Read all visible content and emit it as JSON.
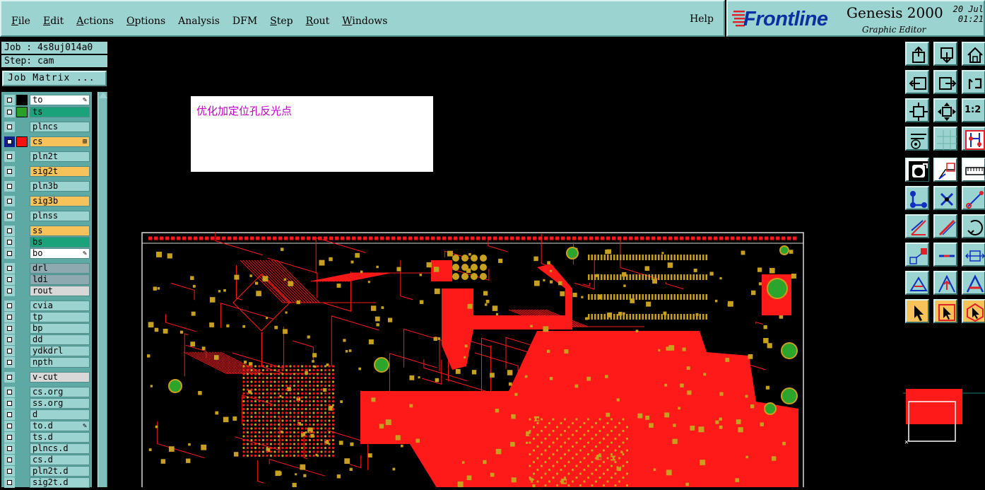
{
  "menu": {
    "items": [
      {
        "label": "File",
        "underline": "F",
        "rest": "ile"
      },
      {
        "label": "Edit",
        "underline": "E",
        "rest": "dit"
      },
      {
        "label": "Actions",
        "underline": "A",
        "rest": "ctions"
      },
      {
        "label": "Options",
        "underline": "O",
        "rest": "ptions"
      },
      {
        "label": "Analysis",
        "underline": "",
        "rest": "Analysis"
      },
      {
        "label": "DFM",
        "underline": "",
        "rest": "DFM"
      },
      {
        "label": "Step",
        "underline": "S",
        "rest": "tep"
      },
      {
        "label": "Rout",
        "underline": "R",
        "rest": "out"
      },
      {
        "label": "Windows",
        "underline": "W",
        "rest": "indows"
      }
    ],
    "help": "Help"
  },
  "brand": {
    "name": "Frontline",
    "product": "Genesis 2000",
    "subtitle": "Graphic Editor",
    "date_line1": "20 Jul",
    "date_line2": "01:21",
    "logo_color": "#e0202a",
    "name_color": "#0b2fa0"
  },
  "job": {
    "job_line": "Job : 4s8uj014a0",
    "step_line": "Step: cam",
    "matrix_button": "Job Matrix ..."
  },
  "layers": [
    {
      "name": "to",
      "bg": "#ffffff",
      "swatch": "#000000",
      "mark": "✎"
    },
    {
      "name": "ts",
      "bg": "#1aa37a",
      "swatch": "#2aa02a",
      "mark": ""
    },
    {
      "name": "plncs",
      "bg": "#9bd3d0",
      "swatch": "",
      "mark": ""
    },
    {
      "name": "cs",
      "bg": "#f7c25a",
      "swatch": "#ff1010",
      "mark": "⊞",
      "active": true
    },
    {
      "name": "pln2t",
      "bg": "#9bd3d0",
      "swatch": "",
      "mark": ""
    },
    {
      "name": "sig2t",
      "bg": "#f7c25a",
      "swatch": "",
      "mark": ""
    },
    {
      "name": "pln3b",
      "bg": "#9bd3d0",
      "swatch": "",
      "mark": ""
    },
    {
      "name": "sig3b",
      "bg": "#f7c25a",
      "swatch": "",
      "mark": ""
    },
    {
      "name": "plnss",
      "bg": "#9bd3d0",
      "swatch": "",
      "mark": ""
    },
    {
      "name": "ss",
      "bg": "#f7c25a",
      "swatch": "",
      "mark": ""
    },
    {
      "name": "bs",
      "bg": "#1aa37a",
      "swatch": "",
      "mark": ""
    },
    {
      "name": "bo",
      "bg": "#ffffff",
      "swatch": "",
      "mark": "✎"
    },
    {
      "name": "drl",
      "bg": "#8fa9b0",
      "swatch": "",
      "mark": ""
    },
    {
      "name": "ldi",
      "bg": "#8fa9b0",
      "swatch": "",
      "mark": ""
    },
    {
      "name": "rout",
      "bg": "#d8d8d8",
      "swatch": "",
      "mark": ""
    },
    {
      "name": "cvia",
      "bg": "#9bd3d0",
      "swatch": "",
      "mark": ""
    },
    {
      "name": "tp",
      "bg": "#9bd3d0",
      "swatch": "",
      "mark": ""
    },
    {
      "name": "bp",
      "bg": "#9bd3d0",
      "swatch": "",
      "mark": ""
    },
    {
      "name": "dd",
      "bg": "#9bd3d0",
      "swatch": "",
      "mark": ""
    },
    {
      "name": "ydkdrl",
      "bg": "#9bd3d0",
      "swatch": "",
      "mark": ""
    },
    {
      "name": "npth",
      "bg": "#9bd3d0",
      "swatch": "",
      "mark": ""
    },
    {
      "name": "v-cut",
      "bg": "#d8d8d8",
      "swatch": "",
      "mark": ""
    },
    {
      "name": "cs.org",
      "bg": "#9bd3d0",
      "swatch": "",
      "mark": ""
    },
    {
      "name": "ss.org",
      "bg": "#9bd3d0",
      "swatch": "",
      "mark": ""
    },
    {
      "name": "d",
      "bg": "#9bd3d0",
      "swatch": "",
      "mark": ""
    },
    {
      "name": "to.d",
      "bg": "#9bd3d0",
      "swatch": "",
      "mark": "✎"
    },
    {
      "name": "ts.d",
      "bg": "#9bd3d0",
      "swatch": "",
      "mark": ""
    },
    {
      "name": "plncs.d",
      "bg": "#9bd3d0",
      "swatch": "",
      "mark": ""
    },
    {
      "name": "cs.d",
      "bg": "#9bd3d0",
      "swatch": "",
      "mark": ""
    },
    {
      "name": "pln2t.d",
      "bg": "#9bd3d0",
      "swatch": "",
      "mark": ""
    },
    {
      "name": "sig2t.d",
      "bg": "#9bd3d0",
      "swatch": "",
      "mark": ""
    }
  ],
  "message": {
    "text": "优化加定位孔反光点"
  },
  "colors": {
    "copper": "#ff1a1a",
    "pad": "#c8a020",
    "via": "#2ca52c",
    "panel": "#9bd3d0",
    "canvas": "#000000"
  },
  "toolbar": {
    "buttons": [
      {
        "name": "zoom-home-icon",
        "style": "panel"
      },
      {
        "name": "zoom-out-icon",
        "style": "panel"
      },
      {
        "name": "home-icon",
        "style": "panel"
      },
      {
        "name": "pan-left-icon",
        "style": "panel"
      },
      {
        "name": "pan-right-icon",
        "style": "panel"
      },
      {
        "name": "undo-icon",
        "style": "panel"
      },
      {
        "name": "fit-screen-icon",
        "style": "panel"
      },
      {
        "name": "fit-profile-icon",
        "style": "panel"
      },
      {
        "name": "ratio-icon",
        "style": "panel",
        "text": "1:2"
      },
      {
        "name": "measure-tools-icon",
        "style": "panel"
      },
      {
        "name": "grid-icon",
        "style": "panel"
      },
      {
        "name": "netlist-icon",
        "style": "panel"
      },
      {
        "name": "snap-pad-icon",
        "style": "white"
      },
      {
        "name": "snap-corner-icon",
        "style": "white"
      },
      {
        "name": "ruler-icon",
        "style": "white"
      },
      {
        "name": "connect-icon",
        "style": "panel"
      },
      {
        "name": "cross-icon",
        "style": "panel"
      },
      {
        "name": "pad-line-icon",
        "style": "panel"
      },
      {
        "name": "angle-line-icon",
        "style": "panel"
      },
      {
        "name": "diagonal-line-icon",
        "style": "panel"
      },
      {
        "name": "arc-icon",
        "style": "panel"
      },
      {
        "name": "diagonal-pads-icon",
        "style": "panel"
      },
      {
        "name": "horizontal-line-icon",
        "style": "panel"
      },
      {
        "name": "measure-distance-icon",
        "style": "panel"
      },
      {
        "name": "triangle-icon",
        "style": "panel"
      },
      {
        "name": "triangle-arrow-icon",
        "style": "panel"
      },
      {
        "name": "triangle-bar-icon",
        "style": "panel"
      },
      {
        "name": "select-arrow-icon",
        "style": "orange"
      },
      {
        "name": "select-box-icon",
        "style": "orange"
      },
      {
        "name": "select-poly-icon",
        "style": "orange"
      }
    ],
    "ratio_label": "1:2"
  }
}
